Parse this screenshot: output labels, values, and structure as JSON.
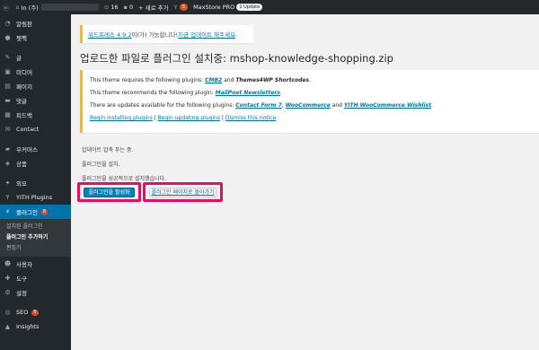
{
  "admin_bar": {
    "site_name": "In (주)",
    "comments_count": "16",
    "pending_count": "0",
    "new_label": "+ 새로 추가",
    "yoast_count": "5",
    "theme_name": "MaxStore PRO",
    "update_badge": "1 Update"
  },
  "sidebar": {
    "items": [
      {
        "icon": "dashboard-icon",
        "glyph": "◔",
        "label": "알림판"
      },
      {
        "icon": "jetpack-icon",
        "glyph": "●",
        "label": "젯팩"
      },
      {
        "icon": "posts-icon",
        "glyph": "✎",
        "label": "글"
      },
      {
        "icon": "media-icon",
        "glyph": "▣",
        "label": "미디어"
      },
      {
        "icon": "pages-icon",
        "glyph": "▤",
        "label": "페이지"
      },
      {
        "icon": "comments-icon",
        "glyph": "▬",
        "label": "댓글"
      },
      {
        "icon": "feedback-icon",
        "glyph": "▦",
        "label": "피드백"
      },
      {
        "icon": "contact-icon",
        "glyph": "✉",
        "label": "Contact"
      },
      {
        "icon": "woocommerce-icon",
        "glyph": "▰",
        "label": "우커머스"
      },
      {
        "icon": "products-icon",
        "glyph": "◈",
        "label": "상품"
      },
      {
        "icon": "appearance-icon",
        "glyph": "✦",
        "label": "외모"
      },
      {
        "icon": "yith-icon",
        "glyph": "Y",
        "label": "YITH Plugins"
      },
      {
        "icon": "plugins-icon",
        "glyph": "⚡",
        "label": "플러그인",
        "count": "8"
      },
      {
        "icon": "users-icon",
        "glyph": "☻",
        "label": "사용자"
      },
      {
        "icon": "tools-icon",
        "glyph": "✚",
        "label": "도구"
      },
      {
        "icon": "settings-icon",
        "glyph": "⚙",
        "label": "설정"
      },
      {
        "icon": "seo-icon",
        "glyph": "◎",
        "label": "SEO",
        "count": "5"
      },
      {
        "icon": "insights-icon",
        "glyph": "▲",
        "label": "Insights"
      }
    ],
    "plugins_sub": [
      "설치된 플러그인",
      "플러그인 추가하기",
      "편집기"
    ]
  },
  "nag": {
    "link_text": "워드프레스 4.9.2",
    "middle_text": "이(가) 가능합니다! ",
    "update_link": "지금 업데이트 해주세요",
    "end_text": "."
  },
  "page_title": "업로드한 파일로 플러그인 설치중: mshop-knowledge-shopping.zip",
  "notice": {
    "line1_a": "This theme requires the following plugins: ",
    "line1_p1": "CMB2",
    "line1_and": " and ",
    "line1_p2": "Themes4WP Shortcodes",
    "line1_end": ".",
    "line2_a": "This theme recommends the following plugin: ",
    "line2_p1": "MailPoet Newsletters",
    "line2_end": ".",
    "line3_a": "There are updates available for the following plugins: ",
    "line3_p1": "Contact Form 7",
    "line3_sep1": ", ",
    "line3_p2": "WooCommerce",
    "line3_and": " and ",
    "line3_p3": "YITH WooCommerce Wishlist",
    "line3_end": ".",
    "action_begin_install": "Begin installing plugins",
    "action_sep1": " | ",
    "action_begin_update": "Begin updating plugins",
    "action_sep2": " | ",
    "action_dismiss": "Dismiss this notice"
  },
  "messages": {
    "unpacking": "압데이트 압축 푸는 중.",
    "installing": "플러그인을 설치.",
    "success": "플러그인을 성공적으로 설치했습니다."
  },
  "buttons": {
    "activate": "플러그인을 활성화",
    "return": "플러그인 페이지로 돌아가기"
  },
  "colors": {
    "admin_bar": "#23282d",
    "active_menu": "#0073aa",
    "highlight": "#e0115f",
    "notice_border": "#ffb900",
    "primary_button": "#0085ba"
  }
}
